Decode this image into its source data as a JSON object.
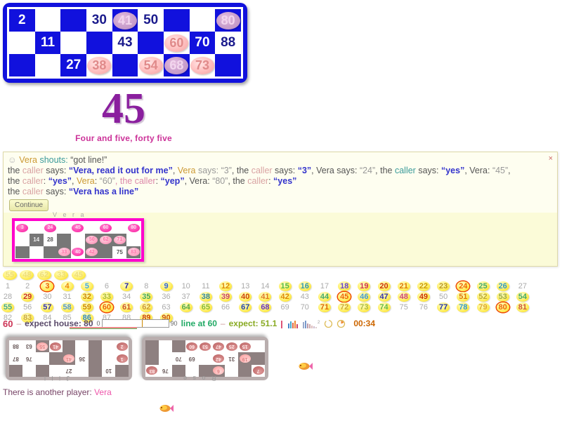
{
  "main_card": {
    "rows": [
      [
        {
          "v": "2",
          "s": "onblue"
        },
        {
          "v": "",
          "s": "empty"
        },
        {
          "v": "",
          "s": "blank"
        },
        {
          "v": "30",
          "s": "white"
        },
        {
          "v": "41",
          "s": "marked-dark"
        },
        {
          "v": "50",
          "s": "white"
        },
        {
          "v": "",
          "s": "blank"
        },
        {
          "v": "",
          "s": "empty"
        },
        {
          "v": "80",
          "s": "marked-dark"
        }
      ],
      [
        {
          "v": "",
          "s": "empty"
        },
        {
          "v": "11",
          "s": "onblue"
        },
        {
          "v": "",
          "s": "empty"
        },
        {
          "v": "",
          "s": "blank"
        },
        {
          "v": "43",
          "s": "white"
        },
        {
          "v": "",
          "s": "blank"
        },
        {
          "v": "60",
          "s": "marked"
        },
        {
          "v": "70",
          "s": "onblue"
        },
        {
          "v": "88",
          "s": "white"
        }
      ],
      [
        {
          "v": "",
          "s": "blank"
        },
        {
          "v": "",
          "s": "empty"
        },
        {
          "v": "27",
          "s": "onblue"
        },
        {
          "v": "38",
          "s": "marked"
        },
        {
          "v": "",
          "s": "blank"
        },
        {
          "v": "54",
          "s": "marked"
        },
        {
          "v": "68",
          "s": "marked-dark"
        },
        {
          "v": "73",
          "s": "marked"
        },
        {
          "v": "",
          "s": "blank"
        }
      ]
    ]
  },
  "called": {
    "number": "45",
    "words": "Four and five, forty five"
  },
  "dialog": {
    "close_label": "×",
    "smiley": "☺",
    "continue_label": "Continue",
    "lines": [
      [
        {
          "t": "☺ ",
          "c": "smiley"
        },
        {
          "t": "Vera ",
          "c": "nm-vera"
        },
        {
          "t": "shouts: ",
          "c": "w-teal"
        },
        {
          "t": "“got line!”",
          "c": "plain"
        }
      ],
      [
        {
          "t": "the ",
          "c": "plain"
        },
        {
          "t": "caller",
          "c": "nm-caller"
        },
        {
          "t": " says: ",
          "c": "plain"
        },
        {
          "t": "“Vera, read it out for me”",
          "c": "w-blue"
        },
        {
          "t": ", ",
          "c": "plain"
        },
        {
          "t": "Vera",
          "c": "nm-vera"
        },
        {
          "t": " says: ",
          "c": "w-gray"
        },
        {
          "t": "“3”",
          "c": "w-gray"
        },
        {
          "t": ", the ",
          "c": "plain"
        },
        {
          "t": "caller",
          "c": "nm-caller"
        },
        {
          "t": " says: ",
          "c": "plain"
        },
        {
          "t": "“3”",
          "c": "w-blue"
        },
        {
          "t": ", Vera says: ",
          "c": "plain"
        },
        {
          "t": "“24”",
          "c": "w-gray"
        },
        {
          "t": ", the ",
          "c": "plain"
        },
        {
          "t": "caller",
          "c": "w-teal"
        },
        {
          "t": " says: ",
          "c": "plain"
        },
        {
          "t": "“yes”",
          "c": "w-blue"
        },
        {
          "t": ", Vera: ",
          "c": "plain"
        },
        {
          "t": "“45”",
          "c": "w-gray"
        },
        {
          "t": ",",
          "c": "plain"
        }
      ],
      [
        {
          "t": "the ",
          "c": "plain"
        },
        {
          "t": "caller",
          "c": "nm-caller"
        },
        {
          "t": ": ",
          "c": "plain"
        },
        {
          "t": "“yes”",
          "c": "w-blue"
        },
        {
          "t": ", ",
          "c": "plain"
        },
        {
          "t": "Vera",
          "c": "nm-vera"
        },
        {
          "t": ": ",
          "c": "plain"
        },
        {
          "t": "“60”",
          "c": "w-gray"
        },
        {
          "t": ", the ",
          "c": "w-pink"
        },
        {
          "t": "caller",
          "c": "w-pink"
        },
        {
          "t": ": ",
          "c": "plain"
        },
        {
          "t": "“yep”",
          "c": "w-blue"
        },
        {
          "t": ", Vera: ",
          "c": "plain"
        },
        {
          "t": "“80”",
          "c": "w-gray"
        },
        {
          "t": ", the ",
          "c": "plain"
        },
        {
          "t": "caller",
          "c": "nm-caller"
        },
        {
          "t": ": ",
          "c": "plain"
        },
        {
          "t": "“yes”",
          "c": "w-blue"
        }
      ],
      [
        {
          "t": "the ",
          "c": "plain"
        },
        {
          "t": "caller",
          "c": "nm-caller"
        },
        {
          "t": " says: ",
          "c": "plain"
        },
        {
          "t": "“Vera has a line”",
          "c": "w-blue"
        }
      ]
    ]
  },
  "vera_card": {
    "title": "V e r a",
    "rows": [
      [
        {
          "v": "3",
          "s": "marked-hot"
        },
        {
          "v": "",
          "s": "empty"
        },
        {
          "v": "24",
          "s": "marked-hot"
        },
        {
          "v": "",
          "s": "empty"
        },
        {
          "v": "45",
          "s": "marked-hot"
        },
        {
          "v": "",
          "s": "empty"
        },
        {
          "v": "60",
          "s": "marked-hot"
        },
        {
          "v": "",
          "s": "empty"
        },
        {
          "v": "80",
          "s": "marked-hot"
        }
      ],
      [
        {
          "v": "",
          "s": "empty"
        },
        {
          "v": "14",
          "s": "ongray"
        },
        {
          "v": "28",
          "s": "white"
        },
        {
          "v": "",
          "s": "blank"
        },
        {
          "v": "",
          "s": "empty"
        },
        {
          "v": "50",
          "s": "marked"
        },
        {
          "v": "62",
          "s": "marked"
        },
        {
          "v": "71",
          "s": "marked"
        },
        {
          "v": "",
          "s": "empty"
        }
      ],
      [
        {
          "v": "",
          "s": "blank"
        },
        {
          "v": "",
          "s": "empty"
        },
        {
          "v": "",
          "s": "blank"
        },
        {
          "v": "33",
          "s": "marked"
        },
        {
          "v": "40",
          "s": "marked-hot"
        },
        {
          "v": "42",
          "s": "marked"
        },
        {
          "v": "",
          "s": "blank"
        },
        {
          "v": "75",
          "s": "white"
        },
        {
          "v": "83",
          "s": "marked"
        }
      ]
    ]
  },
  "board": {
    "recent": [
      "55",
      "48",
      "62",
      "33",
      "45"
    ],
    "numbers": [
      {
        "n": "1",
        "st": "off"
      },
      {
        "n": "2",
        "st": "off"
      },
      {
        "n": "3",
        "st": "ring",
        "col": "#ee6600"
      },
      {
        "n": "4",
        "st": "on",
        "col": "#ee8800"
      },
      {
        "n": "5",
        "st": "on",
        "col": "#44aadd"
      },
      {
        "n": "6",
        "st": "off"
      },
      {
        "n": "7",
        "st": "on",
        "col": "#2222aa"
      },
      {
        "n": "8",
        "st": "off"
      },
      {
        "n": "9",
        "st": "on",
        "col": "#3366cc"
      },
      {
        "n": "10",
        "st": "off"
      },
      {
        "n": "11",
        "st": "off"
      },
      {
        "n": "12",
        "st": "on",
        "col": "#dd8800"
      },
      {
        "n": "13",
        "st": "off"
      },
      {
        "n": "14",
        "st": "off"
      },
      {
        "n": "15",
        "st": "on",
        "col": "#55bb44"
      },
      {
        "n": "16",
        "st": "on",
        "col": "#3399aa"
      },
      {
        "n": "17",
        "st": "off"
      },
      {
        "n": "18",
        "st": "on",
        "col": "#6644cc"
      },
      {
        "n": "19",
        "st": "on",
        "col": "#cc3355"
      },
      {
        "n": "20",
        "st": "on",
        "col": "#cc3300"
      },
      {
        "n": "21",
        "st": "on",
        "col": "#dd7700"
      },
      {
        "n": "22",
        "st": "on",
        "col": "#cc9900"
      },
      {
        "n": "23",
        "st": "on",
        "col": "#bb9922"
      },
      {
        "n": "24",
        "st": "ring",
        "col": "#ee6600"
      },
      {
        "n": "25",
        "st": "on",
        "col": "#44aa66"
      },
      {
        "n": "26",
        "st": "on",
        "col": "#3399bb"
      },
      {
        "n": "27",
        "st": "off"
      },
      {
        "n": "28",
        "st": "off"
      },
      {
        "n": "29",
        "st": "on",
        "col": "#cc3322"
      },
      {
        "n": "30",
        "st": "off"
      },
      {
        "n": "31",
        "st": "off"
      },
      {
        "n": "32",
        "st": "on",
        "col": "#cc8800"
      },
      {
        "n": "33",
        "st": "on",
        "col": "#aabb33"
      },
      {
        "n": "34",
        "st": "off"
      },
      {
        "n": "35",
        "st": "on",
        "col": "#44aa55"
      },
      {
        "n": "36",
        "st": "off"
      },
      {
        "n": "37",
        "st": "off"
      },
      {
        "n": "38",
        "st": "on",
        "col": "#338899"
      },
      {
        "n": "39",
        "st": "on",
        "col": "#cc4466"
      },
      {
        "n": "40",
        "st": "on",
        "col": "#cc4400"
      },
      {
        "n": "41",
        "st": "on",
        "col": "#dd7722"
      },
      {
        "n": "42",
        "st": "on",
        "col": "#dd8800"
      },
      {
        "n": "43",
        "st": "off"
      },
      {
        "n": "44",
        "st": "on",
        "col": "#44aa66"
      },
      {
        "n": "45",
        "st": "ring",
        "col": "#ee6600"
      },
      {
        "n": "46",
        "st": "on",
        "col": "#4499cc"
      },
      {
        "n": "47",
        "st": "on",
        "col": "#3333aa"
      },
      {
        "n": "48",
        "st": "on",
        "col": "#cc4477"
      },
      {
        "n": "49",
        "st": "on",
        "col": "#cc3300"
      },
      {
        "n": "50",
        "st": "off"
      },
      {
        "n": "51",
        "st": "on",
        "col": "#dd7700"
      },
      {
        "n": "52",
        "st": "on",
        "col": "#bbaa33"
      },
      {
        "n": "53",
        "st": "on",
        "col": "#99aa44"
      },
      {
        "n": "54",
        "st": "on",
        "col": "#44aa66"
      },
      {
        "n": "55",
        "st": "on",
        "col": "#44aa88"
      },
      {
        "n": "56",
        "st": "off"
      },
      {
        "n": "57",
        "st": "on",
        "col": "#3333aa"
      },
      {
        "n": "58",
        "st": "on",
        "col": "#5599cc"
      },
      {
        "n": "59",
        "st": "on",
        "col": "#cc8800"
      },
      {
        "n": "60",
        "st": "ring",
        "col": "#ee6600"
      },
      {
        "n": "61",
        "st": "on",
        "col": "#cc5522"
      },
      {
        "n": "62",
        "st": "on",
        "col": "#cc9933"
      },
      {
        "n": "63",
        "st": "off"
      },
      {
        "n": "64",
        "st": "on",
        "col": "#55aa44"
      },
      {
        "n": "65",
        "st": "on",
        "col": "#88bb33"
      },
      {
        "n": "66",
        "st": "off"
      },
      {
        "n": "67",
        "st": "on",
        "col": "#2244aa"
      },
      {
        "n": "68",
        "st": "on",
        "col": "#6633bb"
      },
      {
        "n": "69",
        "st": "off"
      },
      {
        "n": "70",
        "st": "off"
      },
      {
        "n": "71",
        "st": "on",
        "col": "#dd6600"
      },
      {
        "n": "72",
        "st": "on",
        "col": "#ccaa33"
      },
      {
        "n": "73",
        "st": "on",
        "col": "#aabb44"
      },
      {
        "n": "74",
        "st": "on",
        "col": "#66bb44"
      },
      {
        "n": "75",
        "st": "off"
      },
      {
        "n": "76",
        "st": "off"
      },
      {
        "n": "77",
        "st": "on",
        "col": "#2233aa"
      },
      {
        "n": "78",
        "st": "on",
        "col": "#3399cc"
      },
      {
        "n": "79",
        "st": "on",
        "col": "#ddaa33"
      },
      {
        "n": "80",
        "st": "ring",
        "col": "#ee6600"
      },
      {
        "n": "81",
        "st": "on",
        "col": "#cc5533"
      },
      {
        "n": "82",
        "st": "off"
      },
      {
        "n": "83",
        "st": "on",
        "col": "#ccaa44"
      },
      {
        "n": "84",
        "st": "off"
      },
      {
        "n": "85",
        "st": "off"
      },
      {
        "n": "86",
        "st": "on",
        "col": "#3388bb"
      },
      {
        "n": "87",
        "st": "off"
      },
      {
        "n": "88",
        "st": "off"
      },
      {
        "n": "89",
        "st": "on",
        "col": "#cc4400"
      },
      {
        "n": "90",
        "st": "on",
        "col": "#cc5500"
      }
    ]
  },
  "status": {
    "current": "60",
    "dash1": "–",
    "house_label": "expect house: 80",
    "prog_min": "0",
    "prog_max": "90",
    "prog_percent": 67,
    "marker_percent": 60,
    "line_label": "line at 60",
    "dash2": "–",
    "expect_label": "expect: 51.1",
    "timer": "00:34"
  },
  "opponents": [
    {
      "name": "J i l l",
      "rows": [
        [
          {
            "v": "",
            "s": "blank"
          },
          {
            "v": "10",
            "s": "white"
          },
          {
            "v": "",
            "s": "blank"
          },
          {
            "v": "",
            "s": "empty"
          },
          {
            "v": "27",
            "s": "white"
          },
          {
            "v": "",
            "s": "empty"
          },
          {
            "v": "",
            "s": "blank"
          },
          {
            "v": "",
            "s": "empty"
          },
          {
            "v": "",
            "s": "blank"
          }
        ],
        [
          {
            "v": "1",
            "s": "marked-hot"
          },
          {
            "v": "",
            "s": "empty"
          },
          {
            "v": "",
            "s": "blank"
          },
          {
            "v": "36",
            "s": "white"
          },
          {
            "v": "41",
            "s": "marked"
          },
          {
            "v": "",
            "s": "blank"
          },
          {
            "v": "",
            "s": "empty"
          },
          {
            "v": "76",
            "s": "white"
          },
          {
            "v": "87",
            "s": "white"
          }
        ],
        [
          {
            "v": "2",
            "s": "marked-hot"
          },
          {
            "v": "",
            "s": "empty"
          },
          {
            "v": "",
            "s": "blank"
          },
          {
            "v": "",
            "s": "empty"
          },
          {
            "v": "",
            "s": "blank"
          },
          {
            "v": "41",
            "s": "marked-hot"
          },
          {
            "v": "55",
            "s": "marked"
          },
          {
            "v": "63",
            "s": "white"
          },
          {
            "v": "88",
            "s": "white"
          }
        ]
      ]
    },
    {
      "name": "R o s e",
      "rows": [
        [
          {
            "v": "7",
            "s": "marked-hot"
          },
          {
            "v": "",
            "s": "blank"
          },
          {
            "v": "",
            "s": "empty"
          },
          {
            "v": "6",
            "s": "marked"
          },
          {
            "v": "",
            "s": "blank"
          },
          {
            "v": "",
            "s": "empty"
          },
          {
            "v": "",
            "s": "blank"
          },
          {
            "v": "76",
            "s": "white"
          },
          {
            "v": "83",
            "s": "marked-hot"
          }
        ],
        [
          {
            "v": "",
            "s": "blank"
          },
          {
            "v": "19",
            "s": "marked"
          },
          {
            "v": "31",
            "s": "white"
          },
          {
            "v": "42",
            "s": "marked-hot"
          },
          {
            "v": "",
            "s": "empty"
          },
          {
            "v": "69",
            "s": "white"
          },
          {
            "v": "70",
            "s": "white"
          },
          {
            "v": "",
            "s": "empty"
          },
          {
            "v": "",
            "s": "blank"
          }
        ],
        [
          {
            "v": "",
            "s": "empty"
          },
          {
            "v": "15",
            "s": "marked-hot"
          },
          {
            "v": "25",
            "s": "marked-hot"
          },
          {
            "v": "47",
            "s": "marked-hot"
          },
          {
            "v": "53",
            "s": "marked-hot"
          },
          {
            "v": "60",
            "s": "marked-hot"
          },
          {
            "v": "",
            "s": "blank"
          },
          {
            "v": "",
            "s": "empty"
          },
          {
            "v": "",
            "s": "blank"
          }
        ]
      ]
    }
  ],
  "footer": {
    "text": "There is another player: ",
    "player": "Vera"
  },
  "icons": {
    "fish": "fish-icon",
    "bar_small": "bar-chart-small-icon",
    "bar_medium": "bar-chart-medium-icon",
    "bar_wide": "bar-chart-wide-icon",
    "clock_left": "clock-icon",
    "clock_right": "clock-filled-icon"
  }
}
